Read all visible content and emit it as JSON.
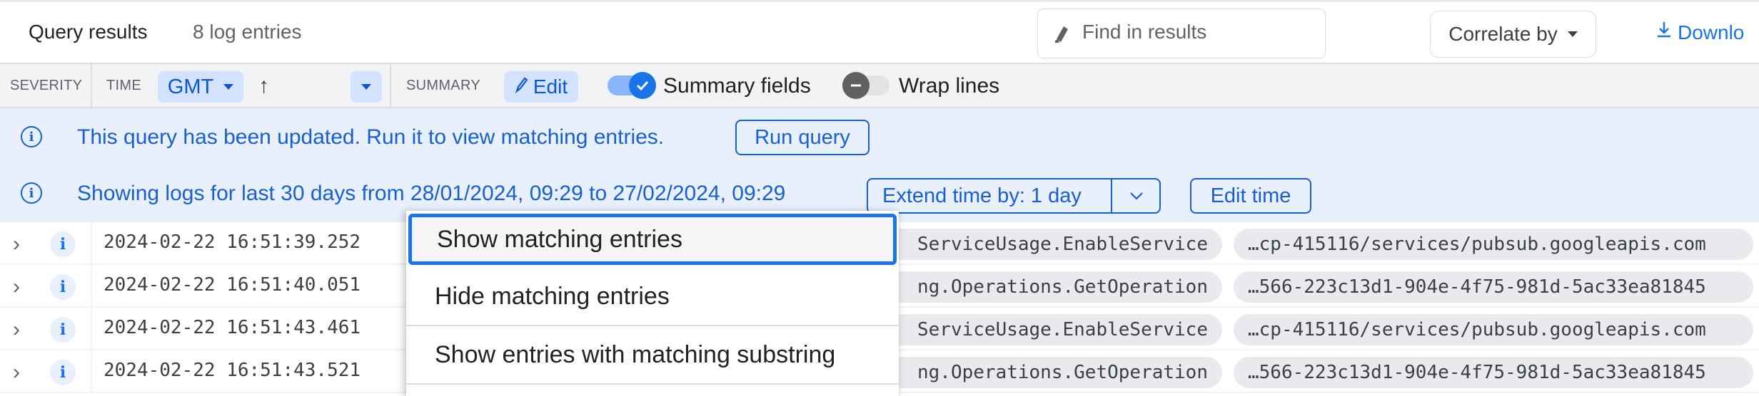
{
  "header": {
    "title": "Query results",
    "count": "8 log entries",
    "find_placeholder": "Find in results",
    "correlate_label": "Correlate by",
    "download_label": "Downlo"
  },
  "columns": {
    "severity": "SEVERITY",
    "time": "TIME",
    "timezone": "GMT",
    "summary": "SUMMARY",
    "edit_label": "Edit",
    "summary_fields_label": "Summary fields",
    "summary_fields_on": true,
    "wrap_lines_label": "Wrap lines",
    "wrap_lines_on": false
  },
  "banners": {
    "query_updated": {
      "text": "This query has been updated. Run it to view matching entries.",
      "button": "Run query"
    },
    "time_range": {
      "text": "Showing logs for last 30 days from 28/01/2024, 09:29 to 27/02/2024, 09:29",
      "extend_label": "Extend time by: 1 day",
      "edit_time_label": "Edit time"
    }
  },
  "rows": [
    {
      "severity": "i",
      "timestamp": "2024-02-22 16:51:39.252",
      "method": "ServiceUsage.EnableService",
      "resource": "…cp-415116/services/pubsub.googleapis.com"
    },
    {
      "severity": "i",
      "timestamp": "2024-02-22 16:51:40.051",
      "method": "ng.Operations.GetOperation",
      "resource": "…566-223c13d1-904e-4f75-981d-5ac33ea81845"
    },
    {
      "severity": "i",
      "timestamp": "2024-02-22 16:51:43.461",
      "method": "ServiceUsage.EnableService",
      "resource": "…cp-415116/services/pubsub.googleapis.com"
    },
    {
      "severity": "i",
      "timestamp": "2024-02-22 16:51:43.521",
      "method": "ng.Operations.GetOperation",
      "resource": "…566-223c13d1-904e-4f75-981d-5ac33ea81845"
    }
  ],
  "context_menu": {
    "items": [
      {
        "label": "Show matching entries",
        "focused": true
      },
      {
        "label": "Hide matching entries",
        "focused": false
      },
      {
        "label": "Show entries with matching substring",
        "focused": false
      }
    ]
  },
  "colors": {
    "accent": "#1a73e8",
    "banner_bg": "#e8f0fe",
    "banner_text": "#1a5fd0",
    "chip_bg": "#d3e3fd",
    "header_bar_bg": "#f1f3f4"
  }
}
